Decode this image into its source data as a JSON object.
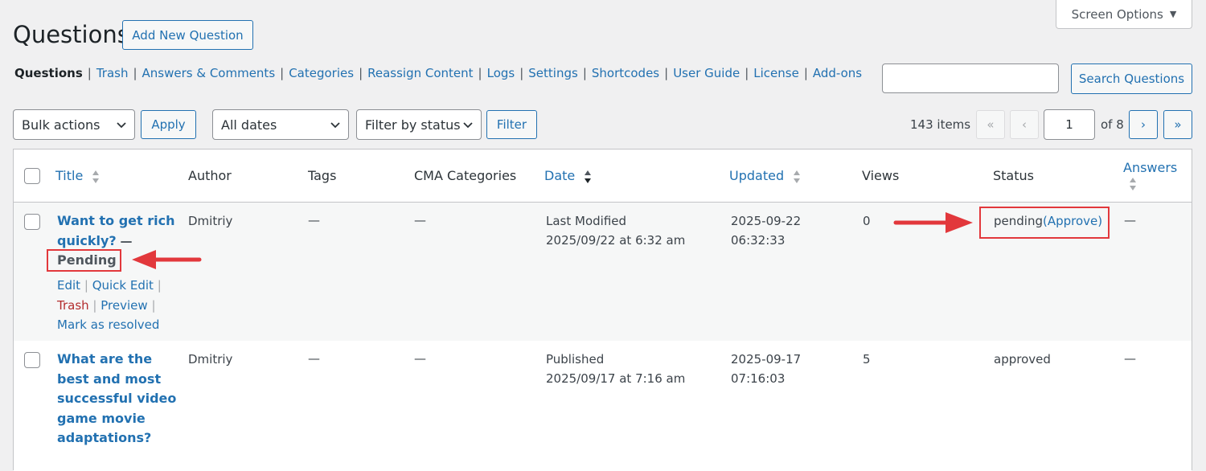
{
  "screen_options": {
    "label": "Screen Options"
  },
  "header": {
    "title": "Questions",
    "add_new_label": "Add New Question"
  },
  "subnav": {
    "items": [
      "Questions",
      "Trash",
      "Answers & Comments",
      "Categories",
      "Reassign Content",
      "Logs",
      "Settings",
      "Shortcodes",
      "User Guide",
      "License",
      "Add-ons"
    ],
    "separator": "|"
  },
  "search": {
    "button_label": "Search Questions",
    "value": ""
  },
  "toolbar": {
    "bulk_actions": "Bulk actions",
    "apply": "Apply",
    "dates": "All dates",
    "status_filter": "Filter by status",
    "filter": "Filter"
  },
  "pagination": {
    "items_count": "143 items",
    "first": "«",
    "prev": "‹",
    "next": "›",
    "last": "»",
    "current_page": "1",
    "of_total": "of 8"
  },
  "table": {
    "columns": {
      "title": "Title",
      "author": "Author",
      "tags": "Tags",
      "categories": "CMA Categories",
      "date": "Date",
      "updated": "Updated",
      "views": "Views",
      "status": "Status",
      "answers": "Answers"
    },
    "rows": [
      {
        "title_line1": "Want to get rich",
        "title_line2": "quickly?",
        "dash_suffix": "—",
        "state": "Pending",
        "actions": {
          "edit": "Edit",
          "quick_edit": "Quick Edit",
          "trash": "Trash",
          "preview": "Preview",
          "resolve": "Mark as resolved",
          "sep": "|"
        },
        "author": "Dmitriy",
        "tags": "—",
        "categories": "—",
        "date_status": "Last Modified",
        "date_value": "2025/09/22 at 6:32 am",
        "updated_date": "2025-09-22",
        "updated_time": "06:32:33",
        "views": "0",
        "status_text": "pending",
        "status_link": "(Approve)",
        "answers": "—"
      },
      {
        "title_lines": [
          "What are the",
          "best and most",
          "successful video",
          "game movie",
          "adaptations?"
        ],
        "author": "Dmitriy",
        "tags": "—",
        "categories": "—",
        "date_status": "Published",
        "date_value": "2025/09/17 at 7:16 am",
        "updated_date": "2025-09-17",
        "updated_time": "07:16:03",
        "views": "5",
        "status_text": "approved",
        "answers": "—"
      }
    ]
  },
  "annotations": {
    "color": "#e2383c"
  }
}
